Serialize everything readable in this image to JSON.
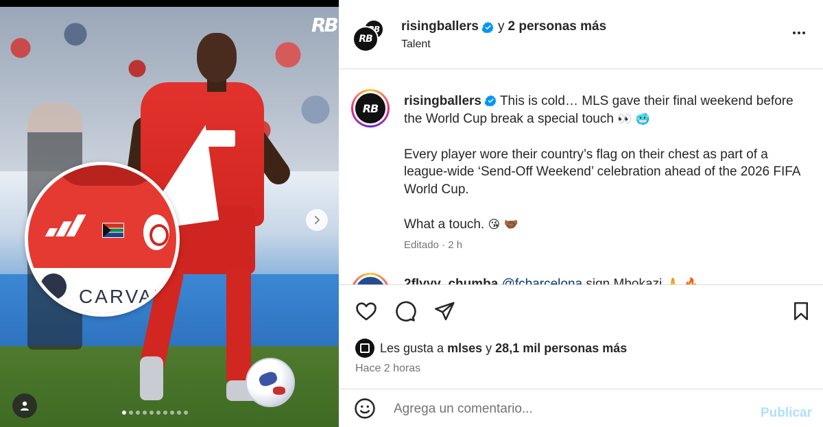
{
  "media": {
    "watermark": "RB",
    "zoom_sponsor_text": "CARVAN",
    "carousel_total": 10,
    "carousel_active_index": 0
  },
  "header": {
    "username": "risingballers",
    "connector": "y",
    "others": "2 personas más",
    "subtitle": "Talent",
    "avatar_text": "RB"
  },
  "caption": {
    "username": "risingballers",
    "line1": "This is cold… MLS gave their final weekend before the World Cup break a special touch",
    "line1_emoji": "👀 🥶",
    "para2": "Every player wore their country’s flag on their chest as part of a league-wide ‘Send-Off Weekend’ celebration ahead of the 2026 FIFA World Cup.",
    "para3": "What a touch.",
    "para3_emoji": "😘 🤝🏾",
    "meta": "Editado · 2 h"
  },
  "comment2": {
    "username": "2flyyy_chumba",
    "mention": "@fcbarcelona",
    "text": "sign Mbokazi",
    "emoji": "🙏 🔥"
  },
  "likes": {
    "prefix": "Les gusta a",
    "user": "mlses",
    "connector": "y",
    "others": "28,1 mil personas más"
  },
  "time": "Hace 2 horas",
  "comment_bar": {
    "placeholder": "Agrega un comentario...",
    "publish_label": "Publicar"
  },
  "colors": {
    "verified": "#0095f6",
    "muted": "#737373",
    "publish_disabled": "#b2dffc",
    "border": "#dbdbdb"
  }
}
